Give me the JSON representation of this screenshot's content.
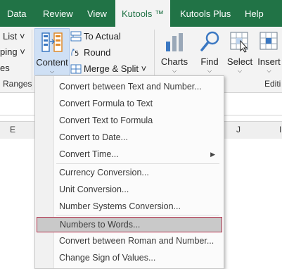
{
  "tabs": [
    "Data",
    "Review",
    "View",
    "Kutools ™",
    "Kutools Plus",
    "Help"
  ],
  "active_tab": "Kutools ™",
  "ribbon": {
    "left_partial": [
      "List ˅",
      "ping ˅",
      "es"
    ],
    "content_label": "Content",
    "to_actual": "To Actual",
    "round": "Round",
    "merge_split": "Merge & Split ˅",
    "charts": "Charts",
    "find": "Find",
    "select": "Select",
    "insert": "Insert",
    "group_ranges": "Ranges &",
    "group_editing": "Editi"
  },
  "columns": [
    "E",
    "J",
    "I"
  ],
  "menu": {
    "items": [
      "Convert between Text and Number...",
      "Convert Formula to Text",
      "Convert Text to Formula",
      "Convert to Date...",
      "Convert Time...",
      "Currency Conversion...",
      "Unit Conversion...",
      "Number Systems Conversion...",
      "Numbers to Words...",
      "Convert between Roman and Number...",
      "Change Sign of Values..."
    ],
    "selected": "Numbers to Words..."
  },
  "colors": {
    "excel_green": "#217346",
    "highlight_border": "#b4334d",
    "selected_bg": "#c9c9c9"
  }
}
